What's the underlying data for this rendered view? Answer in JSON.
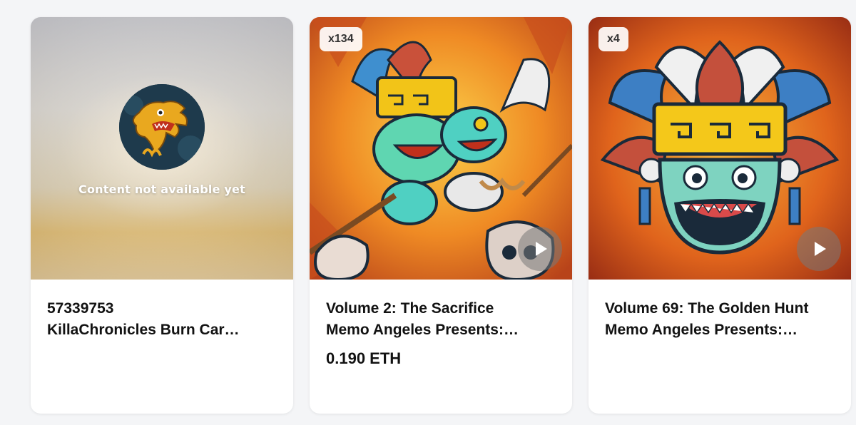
{
  "cards": [
    {
      "status_text": "Content not available yet",
      "title_line1": "57339753",
      "title_line2": "KillaChronicles Burn Car…",
      "price": ""
    },
    {
      "badge": "x134",
      "title_line1": "Volume 2: The Sacrifice",
      "title_line2": "Memo Angeles Presents:…",
      "price": "0.190 ETH",
      "has_video": true
    },
    {
      "badge": "x4",
      "title_line1": "Volume 69: The Golden Hunt",
      "title_line2": "Memo Angeles Presents:…",
      "price": "",
      "has_video": true
    }
  ],
  "icons": {
    "play": "play-icon",
    "avatar": "dragon-avatar"
  },
  "colors": {
    "page_bg": "#f4f5f7",
    "card_bg": "#ffffff",
    "text": "#121212",
    "art_orange": "#e8751e"
  }
}
